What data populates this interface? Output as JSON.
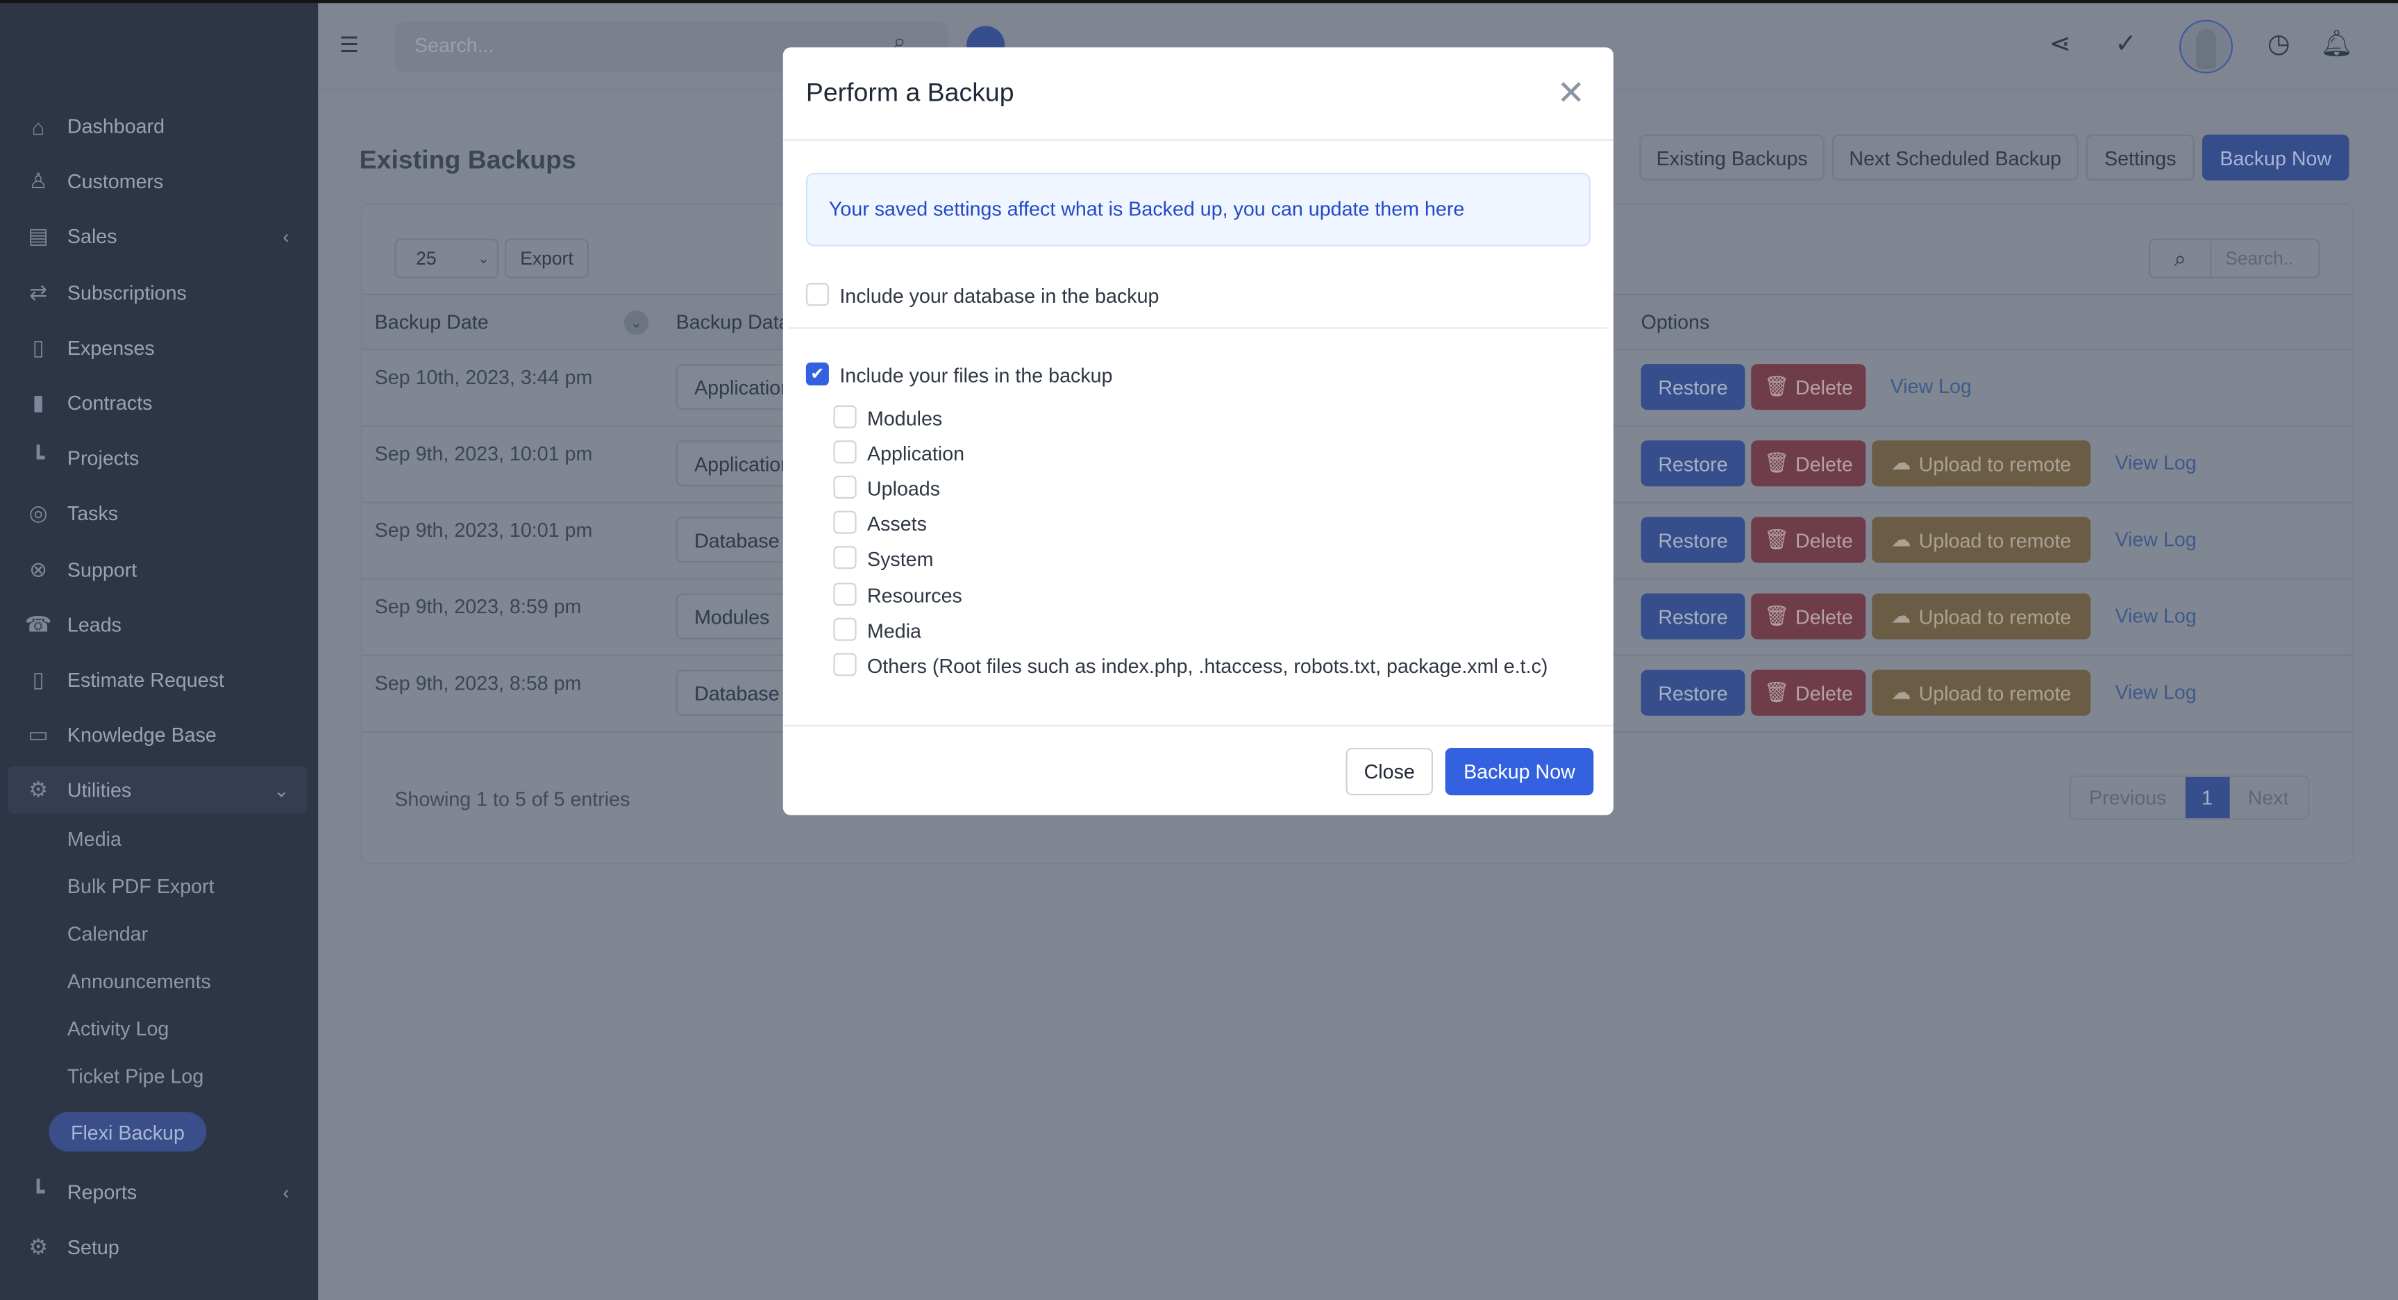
{
  "header": {
    "search_placeholder": "Search...",
    "icons": [
      "menu-icon",
      "search-icon",
      "plus-icon",
      "share-icon",
      "check-icon",
      "avatar",
      "clock-icon",
      "bell-icon"
    ]
  },
  "sidebar": {
    "items": [
      {
        "label": "Dashboard",
        "icon": "home-icon",
        "glyph": "⌂"
      },
      {
        "label": "Customers",
        "icon": "user-icon",
        "glyph": "♙"
      },
      {
        "label": "Sales",
        "icon": "receipt-icon",
        "glyph": "▤",
        "chevron": "‹"
      },
      {
        "label": "Subscriptions",
        "icon": "repeat-icon",
        "glyph": "⇄"
      },
      {
        "label": "Expenses",
        "icon": "file-icon",
        "glyph": "▯"
      },
      {
        "label": "Contracts",
        "icon": "contract-icon",
        "glyph": "▮"
      },
      {
        "label": "Projects",
        "icon": "chart-icon",
        "glyph": "┗"
      },
      {
        "label": "Tasks",
        "icon": "check-circle-icon",
        "glyph": "◎"
      },
      {
        "label": "Support",
        "icon": "lifebuoy-icon",
        "glyph": "⊗"
      },
      {
        "label": "Leads",
        "icon": "tty-icon",
        "glyph": "☎"
      },
      {
        "label": "Estimate Request",
        "icon": "document-icon",
        "glyph": "▯"
      },
      {
        "label": "Knowledge Base",
        "icon": "folder-icon",
        "glyph": "▭"
      },
      {
        "label": "Utilities",
        "icon": "cogs-icon",
        "glyph": "⚙",
        "chevron": "⌄",
        "open": true
      }
    ],
    "sub_items": [
      "Media",
      "Bulk PDF Export",
      "Calendar",
      "Announcements",
      "Activity Log",
      "Ticket Pipe Log"
    ],
    "active_sub": "Flexi Backup",
    "bottom_items": [
      {
        "label": "Reports",
        "icon": "bar-chart-icon",
        "glyph": "┗",
        "chevron": "‹"
      },
      {
        "label": "Setup",
        "icon": "gear-icon",
        "glyph": "⚙"
      }
    ]
  },
  "page": {
    "title": "Existing Backups",
    "tabs": [
      "Existing Backups",
      "Next Scheduled Backup",
      "Settings",
      "Backup Now"
    ],
    "page_size": "25",
    "export_label": "Export",
    "search_placeholder": "Search..",
    "columns": [
      "Backup Date",
      "Backup Data",
      "Options"
    ],
    "rows": [
      {
        "date": "Sep 10th, 2023, 3:44 pm",
        "data": "Application",
        "upload": false
      },
      {
        "date": "Sep 9th, 2023, 10:01 pm",
        "data": "Application",
        "upload": true
      },
      {
        "date": "Sep 9th, 2023, 10:01 pm",
        "data": "Database",
        "upload": true
      },
      {
        "date": "Sep 9th, 2023, 8:59 pm",
        "data": "Modules",
        "upload": true
      },
      {
        "date": "Sep 9th, 2023, 8:58 pm",
        "data": "Database",
        "upload": true
      }
    ],
    "actions": {
      "restore": "Restore",
      "delete": "Delete",
      "upload": "Upload to remote",
      "view_log": "View Log"
    },
    "showing": "Showing 1 to 5 of 5 entries",
    "pagination": {
      "previous": "Previous",
      "current": "1",
      "next": "Next"
    }
  },
  "modal": {
    "title": "Perform a Backup",
    "info": "Your saved settings affect what is Backed up, you can update them here",
    "database_label": "Include your database in the backup",
    "database_checked": false,
    "files_label": "Include your files in the backup",
    "files_checked": true,
    "file_options": [
      {
        "label": "Modules",
        "checked": false
      },
      {
        "label": "Application",
        "checked": false
      },
      {
        "label": "Uploads",
        "checked": false
      },
      {
        "label": "Assets",
        "checked": false
      },
      {
        "label": "System",
        "checked": false
      },
      {
        "label": "Resources",
        "checked": false
      },
      {
        "label": "Media",
        "checked": false
      },
      {
        "label": "Others (Root files such as index.php, .htaccess, robots.txt, package.xml e.t.c)",
        "checked": false
      }
    ],
    "close_label": "Close",
    "backup_label": "Backup Now"
  },
  "colors": {
    "primary": "#3461e0",
    "danger": "#b91c1c",
    "warning": "#ca8a04",
    "sidebar": "#2d3546"
  }
}
